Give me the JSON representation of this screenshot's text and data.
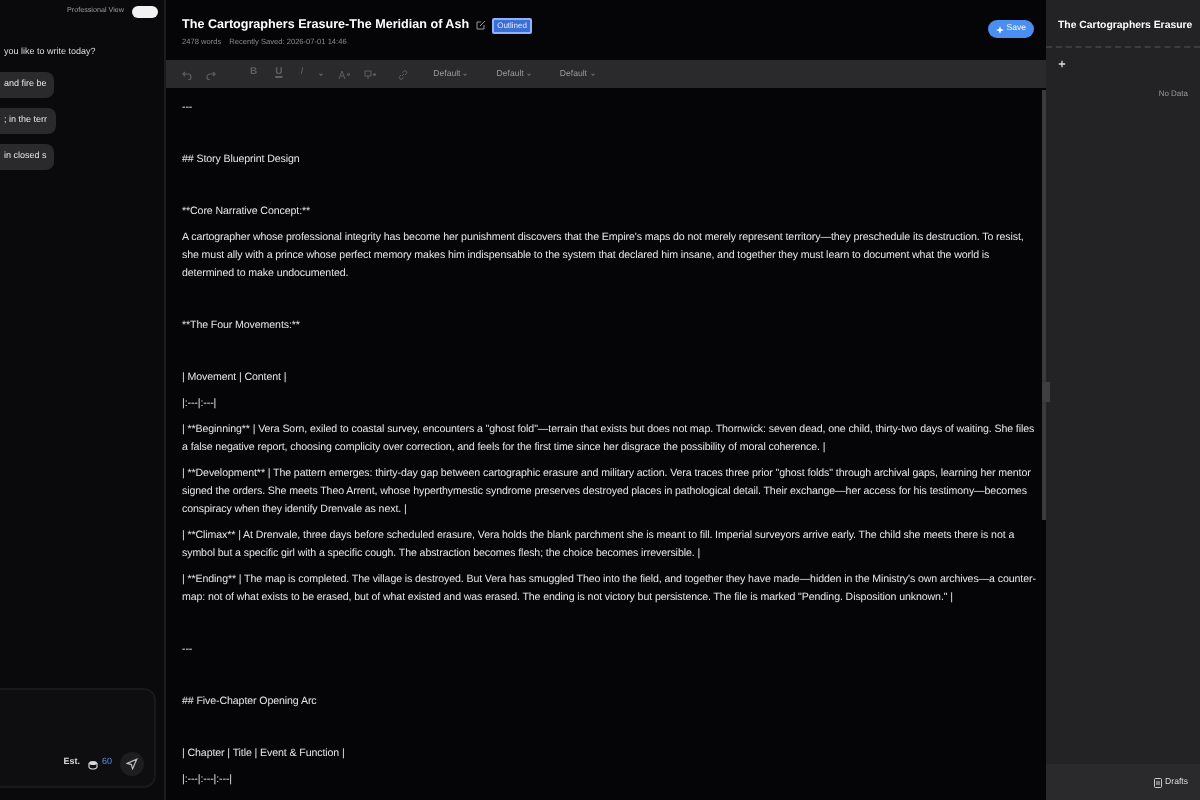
{
  "assistant_panel": {
    "toggle": {
      "label": "Professional View",
      "on": true
    },
    "prompt": "you like to write today?",
    "suggestions": [
      "and fire be",
      "; in the terr",
      "in closed s"
    ],
    "estimate": {
      "label": "Est.",
      "value": "60"
    }
  },
  "document": {
    "title": "The Cartographers Erasure-The Meridian of Ash",
    "badge": "Outlined",
    "words": "2478 words",
    "saved": "Recently Saved: 2026-07-01 14:46",
    "save_button": "Save"
  },
  "toolbar": {
    "format_buttons": [
      "B",
      "U",
      "I"
    ],
    "dropdowns": [
      "Default",
      "Default",
      "Default"
    ]
  },
  "lines": [
    {
      "kind": "block",
      "text": "---"
    },
    {
      "kind": "block",
      "text": "## Story Blueprint Design"
    },
    {
      "kind": "block",
      "text": "**Core Narrative Concept:**"
    },
    {
      "kind": "line",
      "text": "A cartographer whose professional integrity has become her punishment discovers that the Empire's maps do not merely represent territory—they preschedule its destruction. To resist, she must ally with a prince whose perfect memory makes him indispensable to the system that declared him insane, and together they must learn to document what the world is determined to make undocumented."
    },
    {
      "kind": "block",
      "text": "**The Four Movements:**"
    },
    {
      "kind": "block",
      "text": "| Movement | Content |"
    },
    {
      "kind": "line",
      "text": "|:---|:---|"
    },
    {
      "kind": "line",
      "text": "| **Beginning** | Vera Sorn, exiled to coastal survey, encounters a \"ghost fold\"—terrain that exists but does not map. Thornwick: seven dead, one child, thirty-two days of waiting. She files a false negative report, choosing complicity over correction, and feels for the first time since her disgrace the possibility of moral coherence. |"
    },
    {
      "kind": "line",
      "text": "| **Development** | The pattern emerges: thirty-day gap between cartographic erasure and military action. Vera traces three prior \"ghost folds\" through archival gaps, learning her mentor signed the orders. She meets Theo Arrent, whose hyperthymestic syndrome preserves destroyed places in pathological detail. Their exchange—her access for his testimony—becomes conspiracy when they identify Drenvale as next. |"
    },
    {
      "kind": "line",
      "text": "| **Climax** | At Drenvale, three days before scheduled erasure, Vera holds the blank parchment she is meant to fill. Imperial surveyors arrive early. The child she meets there is not a symbol but a specific girl with a specific cough. The abstraction becomes flesh; the choice becomes irreversible. |"
    },
    {
      "kind": "line",
      "text": "| **Ending** | The map is completed. The village is destroyed. But Vera has smuggled Theo into the field, and together they have made—hidden in the Ministry's own archives—a counter-map: not of what exists to be erased, but of what existed and was erased. The ending is not victory but persistence. The file is marked \"Pending. Disposition unknown.\" |"
    },
    {
      "kind": "block",
      "text": "---"
    },
    {
      "kind": "block",
      "text": "## Five-Chapter Opening Arc"
    },
    {
      "kind": "block",
      "text": "| Chapter | Title | Event & Function |"
    },
    {
      "kind": "line",
      "text": "|:---|:---|:---|"
    }
  ],
  "outline_panel": {
    "title": "The Cartographers Erasure",
    "empty_text": "No Data",
    "footer_button": "Drafts"
  }
}
